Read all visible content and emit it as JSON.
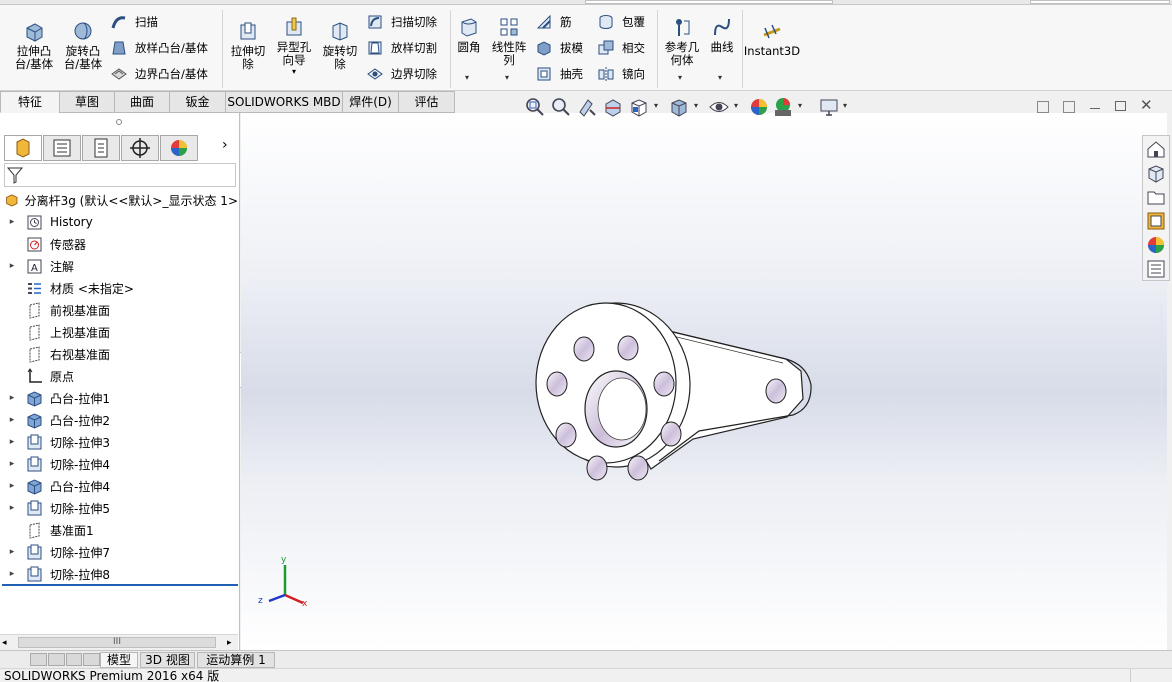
{
  "ribbon": {
    "group1": [
      {
        "label": "拉伸凸\n台/基体",
        "icon": "extruded-boss-icon"
      },
      {
        "label": "旋转凸\n台/基体",
        "icon": "revolved-boss-icon"
      }
    ],
    "group1_small": [
      {
        "label": "扫描",
        "icon": "swept-boss-icon"
      },
      {
        "label": "放样凸台/基体",
        "icon": "lofted-boss-icon"
      },
      {
        "label": "边界凸台/基体",
        "icon": "boundary-boss-icon"
      }
    ],
    "group2": [
      {
        "label": "拉伸切\n除",
        "icon": "extruded-cut-icon"
      },
      {
        "label": "异型孔\n向导",
        "icon": "hole-wizard-icon"
      },
      {
        "label": "旋转切\n除",
        "icon": "revolved-cut-icon"
      }
    ],
    "group2_small": [
      {
        "label": "扫描切除",
        "icon": "swept-cut-icon"
      },
      {
        "label": "放样切割",
        "icon": "lofted-cut-icon"
      },
      {
        "label": "边界切除",
        "icon": "boundary-cut-icon"
      }
    ],
    "group3_big": [
      {
        "label": "圆角",
        "icon": "fillet-icon"
      },
      {
        "label": "线性阵\n列",
        "icon": "linear-pattern-icon"
      }
    ],
    "group3_small_a": [
      {
        "label": "筋",
        "icon": "rib-icon"
      },
      {
        "label": "拔模",
        "icon": "draft-icon"
      },
      {
        "label": "抽壳",
        "icon": "shell-icon"
      }
    ],
    "group3_small_b": [
      {
        "label": "包覆",
        "icon": "wrap-icon"
      },
      {
        "label": "相交",
        "icon": "intersect-icon"
      },
      {
        "label": "镜向",
        "icon": "mirror-icon"
      }
    ],
    "group4": [
      {
        "label": "参考几\n何体",
        "icon": "reference-geometry-icon"
      },
      {
        "label": "曲线",
        "icon": "curves-icon"
      },
      {
        "label": "Instant3D",
        "icon": "instant3d-icon"
      }
    ]
  },
  "tabs": [
    "特征",
    "草图",
    "曲面",
    "钣金",
    "SOLIDWORKS MBD",
    "焊件(D)",
    "评估"
  ],
  "tree": {
    "root": "分离杆3g  (默认<<默认>_显示状态 1>",
    "items": [
      {
        "label": "History",
        "icon": "history-icon",
        "expand": true
      },
      {
        "label": "传感器",
        "icon": "sensor-icon",
        "expand": false
      },
      {
        "label": "注解",
        "icon": "annotation-icon",
        "expand": true
      },
      {
        "label": "材质 <未指定>",
        "icon": "material-icon",
        "expand": false
      },
      {
        "label": "前视基准面",
        "icon": "plane-icon",
        "expand": false
      },
      {
        "label": "上视基准面",
        "icon": "plane-icon",
        "expand": false
      },
      {
        "label": "右视基准面",
        "icon": "plane-icon",
        "expand": false
      },
      {
        "label": "原点",
        "icon": "origin-icon",
        "expand": false
      },
      {
        "label": "凸台-拉伸1",
        "icon": "boss-extrude-icon",
        "expand": true
      },
      {
        "label": "凸台-拉伸2",
        "icon": "boss-extrude-icon",
        "expand": true
      },
      {
        "label": "切除-拉伸3",
        "icon": "cut-extrude-icon",
        "expand": true
      },
      {
        "label": "切除-拉伸4",
        "icon": "cut-extrude-icon",
        "expand": true
      },
      {
        "label": "凸台-拉伸4",
        "icon": "boss-extrude-icon",
        "expand": true
      },
      {
        "label": "切除-拉伸5",
        "icon": "cut-extrude-icon",
        "expand": true
      },
      {
        "label": "基准面1",
        "icon": "plane-icon",
        "expand": false
      },
      {
        "label": "切除-拉伸7",
        "icon": "cut-extrude-icon",
        "expand": true
      },
      {
        "label": "切除-拉伸8",
        "icon": "cut-extrude-icon",
        "expand": true
      }
    ]
  },
  "triad": {
    "x": "x",
    "y": "y",
    "z": "z"
  },
  "hscroll_mark": "III",
  "bottom_tabs": [
    "模型",
    "3D 视图",
    "运动算例 1"
  ],
  "status": "SOLIDWORKS Premium 2016 x64 版",
  "colors": {
    "accent_blue": "#1e5aa8",
    "selection_line": "#1f5fb4",
    "part_fill": "#ffffff",
    "part_shade": "#d9d0e3"
  }
}
